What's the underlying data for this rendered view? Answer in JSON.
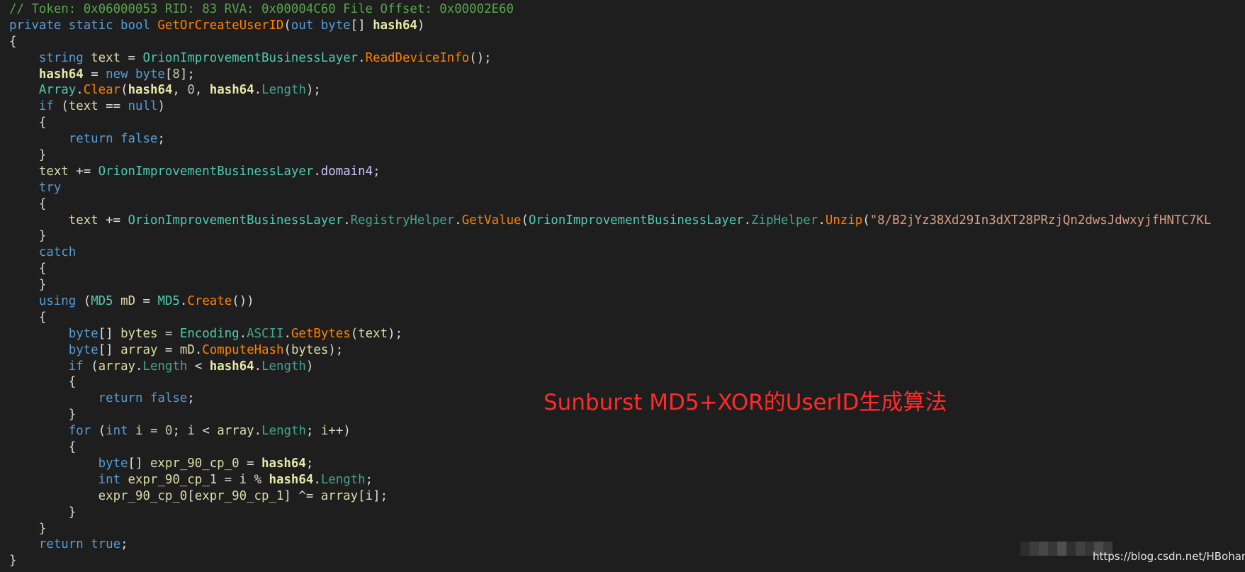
{
  "colors": {
    "background": "#1e1e1e",
    "comment": "#57a64a",
    "keyword": "#569cd6",
    "type": "#4ec9b0",
    "method": "#ff8000",
    "property": "#4ec9b0",
    "variable": "#dcdcaa",
    "number": "#b5cea8",
    "string": "#d69d85",
    "punctuation": "#dcdcdc",
    "field": "#c8c8ff",
    "parameter": "#e8e8a8",
    "caption": "#ff2a2a"
  },
  "code_lines": [
    [
      [
        "cm",
        "// Token: 0x06000053 RID: 83 RVA: 0x00004C60 File Offset: 0x00002E60"
      ]
    ],
    [
      [
        "kw",
        "private static bool "
      ],
      [
        "fn",
        "GetOrCreateUserID"
      ],
      [
        "pu",
        "("
      ],
      [
        "kw",
        "out byte"
      ],
      [
        "pu",
        "[] "
      ],
      [
        "pm",
        "hash64"
      ],
      [
        "pu",
        ")"
      ]
    ],
    [
      [
        "pu",
        "{"
      ]
    ],
    [
      [
        "pu",
        "    "
      ],
      [
        "kw",
        "string "
      ],
      [
        "vr",
        "text"
      ],
      [
        "pu",
        " = "
      ],
      [
        "ty",
        "OrionImprovementBusinessLayer"
      ],
      [
        "pu",
        "."
      ],
      [
        "fn",
        "ReadDeviceInfo"
      ],
      [
        "pu",
        "();"
      ]
    ],
    [
      [
        "pu",
        "    "
      ],
      [
        "pm",
        "hash64"
      ],
      [
        "pu",
        " = "
      ],
      [
        "kw",
        "new byte"
      ],
      [
        "pu",
        "["
      ],
      [
        "nu",
        "8"
      ],
      [
        "pu",
        "];"
      ]
    ],
    [
      [
        "pu",
        "    "
      ],
      [
        "ty",
        "Array"
      ],
      [
        "pu",
        "."
      ],
      [
        "fn",
        "Clear"
      ],
      [
        "pu",
        "("
      ],
      [
        "pm",
        "hash64"
      ],
      [
        "pu",
        ", "
      ],
      [
        "nu",
        "0"
      ],
      [
        "pu",
        ", "
      ],
      [
        "pm",
        "hash64"
      ],
      [
        "pu",
        "."
      ],
      [
        "pr",
        "Length"
      ],
      [
        "pu",
        ");"
      ]
    ],
    [
      [
        "pu",
        "    "
      ],
      [
        "kw",
        "if"
      ],
      [
        "pu",
        " ("
      ],
      [
        "vr",
        "text"
      ],
      [
        "pu",
        " == "
      ],
      [
        "kw",
        "null"
      ],
      [
        "pu",
        ")"
      ]
    ],
    [
      [
        "pu",
        "    {"
      ]
    ],
    [
      [
        "pu",
        "        "
      ],
      [
        "kw",
        "return false"
      ],
      [
        "pu",
        ";"
      ]
    ],
    [
      [
        "pu",
        "    }"
      ]
    ],
    [
      [
        "pu",
        "    "
      ],
      [
        "vr",
        "text"
      ],
      [
        "pu",
        " += "
      ],
      [
        "ty",
        "OrionImprovementBusinessLayer"
      ],
      [
        "pu",
        "."
      ],
      [
        "fd",
        "domain4"
      ],
      [
        "pu",
        ";"
      ]
    ],
    [
      [
        "pu",
        "    "
      ],
      [
        "kw",
        "try"
      ]
    ],
    [
      [
        "pu",
        "    {"
      ]
    ],
    [
      [
        "pu",
        "        "
      ],
      [
        "vr",
        "text"
      ],
      [
        "pu",
        " += "
      ],
      [
        "ty",
        "OrionImprovementBusinessLayer"
      ],
      [
        "pu",
        "."
      ],
      [
        "pr",
        "RegistryHelper"
      ],
      [
        "pu",
        "."
      ],
      [
        "fn",
        "GetValue"
      ],
      [
        "pu",
        "("
      ],
      [
        "ty",
        "OrionImprovementBusinessLayer"
      ],
      [
        "pu",
        "."
      ],
      [
        "pr",
        "ZipHelper"
      ],
      [
        "pu",
        "."
      ],
      [
        "fn",
        "Unzip"
      ],
      [
        "pu",
        "("
      ],
      [
        "st",
        "\"8/B2jYz38Xd29In3dXT28PRzjQn2dwsJdwxyjfHNTC7KL"
      ]
    ],
    [
      [
        "pu",
        "    }"
      ]
    ],
    [
      [
        "pu",
        "    "
      ],
      [
        "kw",
        "catch"
      ]
    ],
    [
      [
        "pu",
        "    {"
      ]
    ],
    [
      [
        "pu",
        "    }"
      ]
    ],
    [
      [
        "pu",
        "    "
      ],
      [
        "kw",
        "using"
      ],
      [
        "pu",
        " ("
      ],
      [
        "ty",
        "MD5"
      ],
      [
        "pu",
        " "
      ],
      [
        "vr",
        "mD"
      ],
      [
        "pu",
        " = "
      ],
      [
        "ty",
        "MD5"
      ],
      [
        "pu",
        "."
      ],
      [
        "fn",
        "Create"
      ],
      [
        "pu",
        "())"
      ]
    ],
    [
      [
        "pu",
        "    {"
      ]
    ],
    [
      [
        "pu",
        "        "
      ],
      [
        "kw",
        "byte"
      ],
      [
        "pu",
        "[] "
      ],
      [
        "vr",
        "bytes"
      ],
      [
        "pu",
        " = "
      ],
      [
        "ty",
        "Encoding"
      ],
      [
        "pu",
        "."
      ],
      [
        "pr",
        "ASCII"
      ],
      [
        "pu",
        "."
      ],
      [
        "fn",
        "GetBytes"
      ],
      [
        "pu",
        "("
      ],
      [
        "vr",
        "text"
      ],
      [
        "pu",
        ");"
      ]
    ],
    [
      [
        "pu",
        "        "
      ],
      [
        "kw",
        "byte"
      ],
      [
        "pu",
        "[] "
      ],
      [
        "vr",
        "array"
      ],
      [
        "pu",
        " = "
      ],
      [
        "vr",
        "mD"
      ],
      [
        "pu",
        "."
      ],
      [
        "fn",
        "ComputeHash"
      ],
      [
        "pu",
        "("
      ],
      [
        "vr",
        "bytes"
      ],
      [
        "pu",
        ");"
      ]
    ],
    [
      [
        "pu",
        "        "
      ],
      [
        "kw",
        "if"
      ],
      [
        "pu",
        " ("
      ],
      [
        "vr",
        "array"
      ],
      [
        "pu",
        "."
      ],
      [
        "pr",
        "Length"
      ],
      [
        "pu",
        " < "
      ],
      [
        "pm",
        "hash64"
      ],
      [
        "pu",
        "."
      ],
      [
        "pr",
        "Length"
      ],
      [
        "pu",
        ")"
      ]
    ],
    [
      [
        "pu",
        "        {"
      ]
    ],
    [
      [
        "pu",
        "            "
      ],
      [
        "kw",
        "return false"
      ],
      [
        "pu",
        ";"
      ]
    ],
    [
      [
        "pu",
        "        }"
      ]
    ],
    [
      [
        "pu",
        "        "
      ],
      [
        "kw",
        "for"
      ],
      [
        "pu",
        " ("
      ],
      [
        "kw",
        "int"
      ],
      [
        "pu",
        " "
      ],
      [
        "vr",
        "i"
      ],
      [
        "pu",
        " = "
      ],
      [
        "nu",
        "0"
      ],
      [
        "pu",
        "; "
      ],
      [
        "vr",
        "i"
      ],
      [
        "pu",
        " < "
      ],
      [
        "vr",
        "array"
      ],
      [
        "pu",
        "."
      ],
      [
        "pr",
        "Length"
      ],
      [
        "pu",
        "; "
      ],
      [
        "vr",
        "i"
      ],
      [
        "pu",
        "++)"
      ]
    ],
    [
      [
        "pu",
        "        {"
      ]
    ],
    [
      [
        "pu",
        "            "
      ],
      [
        "kw",
        "byte"
      ],
      [
        "pu",
        "[] "
      ],
      [
        "vr",
        "expr_90_cp_0"
      ],
      [
        "pu",
        " = "
      ],
      [
        "pm",
        "hash64"
      ],
      [
        "pu",
        ";"
      ]
    ],
    [
      [
        "pu",
        "            "
      ],
      [
        "kw",
        "int"
      ],
      [
        "pu",
        " "
      ],
      [
        "vr",
        "expr_90_cp_1"
      ],
      [
        "pu",
        " = "
      ],
      [
        "vr",
        "i"
      ],
      [
        "pu",
        " % "
      ],
      [
        "pm",
        "hash64"
      ],
      [
        "pu",
        "."
      ],
      [
        "pr",
        "Length"
      ],
      [
        "pu",
        ";"
      ]
    ],
    [
      [
        "pu",
        "            "
      ],
      [
        "vr",
        "expr_90_cp_0"
      ],
      [
        "pu",
        "["
      ],
      [
        "vr",
        "expr_90_cp_1"
      ],
      [
        "pu",
        "] ^= "
      ],
      [
        "vr",
        "array"
      ],
      [
        "pu",
        "["
      ],
      [
        "vr",
        "i"
      ],
      [
        "pu",
        "];"
      ]
    ],
    [
      [
        "pu",
        "        }"
      ]
    ],
    [
      [
        "pu",
        "    }"
      ]
    ],
    [
      [
        "pu",
        "    "
      ],
      [
        "kw",
        "return true"
      ],
      [
        "pu",
        ";"
      ]
    ],
    [
      [
        "pu",
        "}"
      ]
    ]
  ],
  "overlay": {
    "caption": "Sunburst MD5+XOR的UserID生成算法"
  },
  "watermark": {
    "text": "https://blog.csdn.net/HBohan",
    "mosaic_colors": [
      "#3a3a3a",
      "#555555",
      "#6a6a6a",
      "#4a4a4a",
      "#777777",
      "#3f3f3f",
      "#5e5e5e",
      "#484848",
      "#6f6f6f",
      "#525252"
    ]
  }
}
